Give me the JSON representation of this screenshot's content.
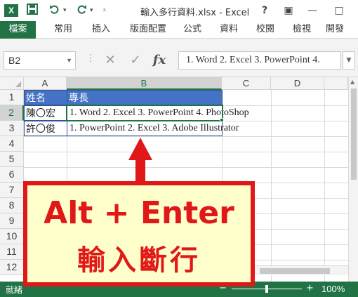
{
  "titlebar": {
    "app_logo": "X",
    "title": "輸入多行資料.xlsx - Excel",
    "help": "?",
    "ribbon_display": "▣",
    "minimize": "—",
    "restore": "□"
  },
  "quick_access": {
    "save_icon": "save-icon",
    "undo_icon": "undo-icon",
    "redo_icon": "redo-icon",
    "customize_icon": "customize-icon"
  },
  "ribbon": {
    "tabs": [
      "檔案",
      "常用",
      "插入",
      "版面配置",
      "公式",
      "資料",
      "校閱",
      "檢視",
      "開發"
    ]
  },
  "formula_bar": {
    "name_box": "B2",
    "cancel_label": "✕",
    "enter_label": "✓",
    "fx_label": "fx",
    "formula": "1. Word 2. Excel 3. PowerPoint 4."
  },
  "grid": {
    "columns": [
      "A",
      "B",
      "C",
      "D"
    ],
    "rows": [
      "1",
      "2",
      "3",
      "4",
      "5",
      "6",
      "7",
      "8",
      "9",
      "10",
      "11",
      "12"
    ],
    "cells": {
      "A1": "姓名",
      "B1": "專長",
      "A2": "陳〇宏",
      "B2": "1. Word 2. Excel 3. PowerPoint 4. PhotoShop",
      "A3": "許〇俊",
      "B3": "1. PowerPoint 2. Excel 3. Adobe Illustrator"
    },
    "selected_cell": "B2"
  },
  "statusbar": {
    "mode": "就緒",
    "zoom_out": "−",
    "zoom_in": "+",
    "zoom": "100%"
  },
  "annotation": {
    "line1": "Alt + Enter",
    "line2": "輸入斷行"
  },
  "colors": {
    "excel_green": "#217346",
    "header_fill": "#4472c4",
    "annotation_red": "#e11818",
    "annotation_fill": "#ffffcc"
  }
}
